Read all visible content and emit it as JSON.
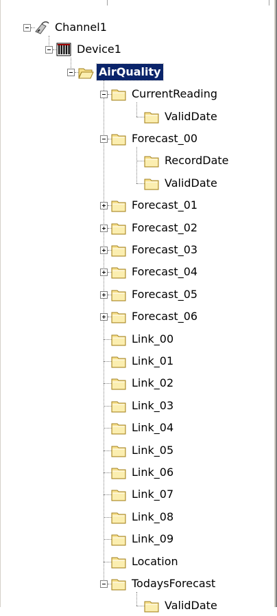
{
  "tree": {
    "nodes": [
      {
        "label": "Channel1",
        "level": 0,
        "icon": "channel-icon",
        "expanded": true
      },
      {
        "label": "Device1",
        "level": 1,
        "icon": "device-icon",
        "expanded": true
      },
      {
        "label": "AirQuality",
        "level": 2,
        "icon": "open-folder-icon",
        "expanded": true,
        "selected": true
      },
      {
        "label": "CurrentReading",
        "level": 3,
        "icon": "folder-icon",
        "expanded": true
      },
      {
        "label": "ValidDate",
        "level": 4,
        "icon": "folder-icon"
      },
      {
        "label": "Forecast_00",
        "level": 3,
        "icon": "folder-icon",
        "expanded": true
      },
      {
        "label": "RecordDate",
        "level": 4,
        "icon": "folder-icon"
      },
      {
        "label": "ValidDate",
        "level": 4,
        "icon": "folder-icon"
      },
      {
        "label": "Forecast_01",
        "level": 3,
        "icon": "folder-icon",
        "expanded": false
      },
      {
        "label": "Forecast_02",
        "level": 3,
        "icon": "folder-icon",
        "expanded": false
      },
      {
        "label": "Forecast_03",
        "level": 3,
        "icon": "folder-icon",
        "expanded": false
      },
      {
        "label": "Forecast_04",
        "level": 3,
        "icon": "folder-icon",
        "expanded": false
      },
      {
        "label": "Forecast_05",
        "level": 3,
        "icon": "folder-icon",
        "expanded": false
      },
      {
        "label": "Forecast_06",
        "level": 3,
        "icon": "folder-icon",
        "expanded": false
      },
      {
        "label": "Link_00",
        "level": 3,
        "icon": "folder-icon"
      },
      {
        "label": "Link_01",
        "level": 3,
        "icon": "folder-icon"
      },
      {
        "label": "Link_02",
        "level": 3,
        "icon": "folder-icon"
      },
      {
        "label": "Link_03",
        "level": 3,
        "icon": "folder-icon"
      },
      {
        "label": "Link_04",
        "level": 3,
        "icon": "folder-icon"
      },
      {
        "label": "Link_05",
        "level": 3,
        "icon": "folder-icon"
      },
      {
        "label": "Link_06",
        "level": 3,
        "icon": "folder-icon"
      },
      {
        "label": "Link_07",
        "level": 3,
        "icon": "folder-icon"
      },
      {
        "label": "Link_08",
        "level": 3,
        "icon": "folder-icon"
      },
      {
        "label": "Link_09",
        "level": 3,
        "icon": "folder-icon"
      },
      {
        "label": "Location",
        "level": 3,
        "icon": "folder-icon"
      },
      {
        "label": "TodaysForecast",
        "level": 3,
        "icon": "folder-icon",
        "expanded": true
      },
      {
        "label": "ValidDate",
        "level": 4,
        "icon": "folder-icon"
      }
    ]
  },
  "colors": {
    "selection_bg": "#0a246a",
    "folder_fill": "#f7e08c",
    "folder_edge": "#a08020"
  }
}
